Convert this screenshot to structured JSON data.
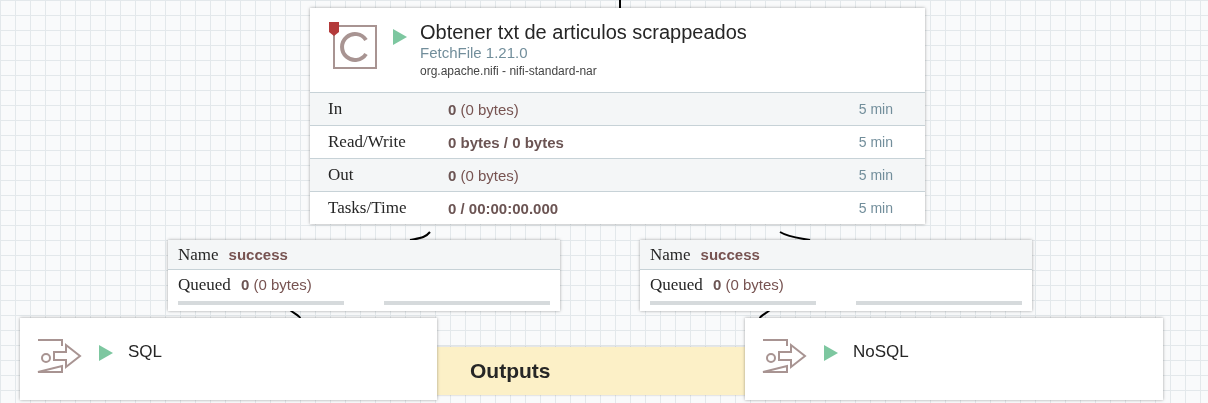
{
  "processor": {
    "name": "Obtener txt de articulos scrappeados",
    "type": "FetchFile 1.21.0",
    "bundle": "org.apache.nifi - nifi-standard-nar",
    "running": true,
    "stats": [
      {
        "label": "In",
        "value": "**0** (0 bytes)",
        "window": "5 min"
      },
      {
        "label": "Read/Write",
        "value": "**0 bytes / 0 bytes**",
        "window": "5 min"
      },
      {
        "label": "Out",
        "value": "**0** (0 bytes)",
        "window": "5 min"
      },
      {
        "label": "Tasks/Time",
        "value": "**0 / 00:00:00.000**",
        "window": "5 min"
      }
    ]
  },
  "connections": [
    {
      "name_label": "Name",
      "name": "success",
      "queued_label": "Queued",
      "queued": "**0** (0 bytes)",
      "meters": [
        {
          "level": 0
        },
        {
          "level": 0
        }
      ]
    },
    {
      "name_label": "Name",
      "name": "success",
      "queued_label": "Queued",
      "queued": "**0** (0 bytes)",
      "meters": [
        {
          "level": 0
        },
        {
          "level": 0
        }
      ]
    }
  ],
  "label": {
    "text": "Outputs"
  },
  "output_ports": [
    {
      "name": "SQL",
      "running": true
    },
    {
      "name": "NoSQL",
      "running": true
    }
  ]
}
